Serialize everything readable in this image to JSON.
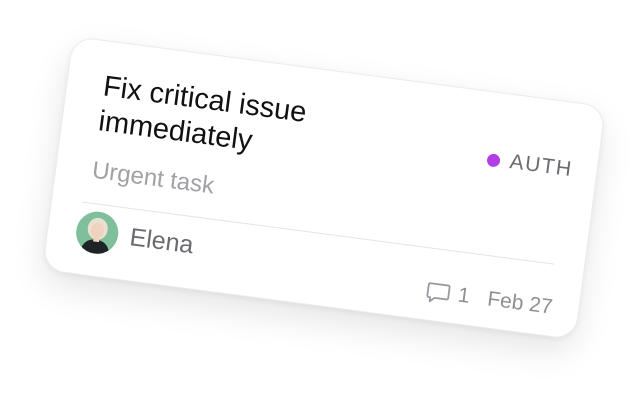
{
  "card": {
    "title": "Fix critical issue immediately",
    "tag": {
      "label": "AUTH",
      "color": "#b23ee8"
    },
    "subtitle": "Urgent task",
    "assignee": {
      "name": "Elena",
      "avatar_icon": "avatar-person-icon"
    },
    "comments": {
      "icon": "comment-icon",
      "count": "1"
    },
    "due_date": "Feb 27"
  }
}
